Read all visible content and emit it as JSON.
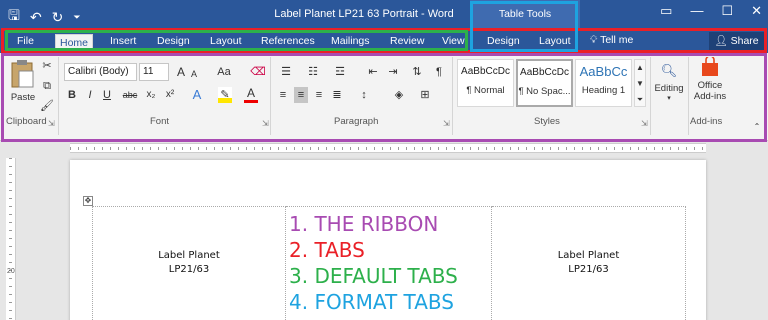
{
  "titlebar": {
    "title": "Label Planet LP21 63 Portrait  -  Word",
    "qat_icons": [
      "save-icon",
      "undo-icon",
      "redo-icon",
      "customize-qat-icon"
    ],
    "qat_glyphs": [
      "🖫",
      "↶",
      "↻",
      "⏷"
    ],
    "window_glyphs": [
      "▭",
      "—",
      "☐",
      "✕"
    ]
  },
  "contextual": {
    "title": "Table Tools"
  },
  "tabs": [
    {
      "label": "File"
    },
    {
      "label": "Home"
    },
    {
      "label": "Insert"
    },
    {
      "label": "Design"
    },
    {
      "label": "Layout"
    },
    {
      "label": "References"
    },
    {
      "label": "Mailings"
    },
    {
      "label": "Review"
    },
    {
      "label": "View"
    },
    {
      "label": "Design"
    },
    {
      "label": "Layout"
    }
  ],
  "tell_me": "Tell me",
  "share": "Share",
  "ribbon": {
    "clipboard": {
      "label": "Clipboard",
      "paste": "Paste"
    },
    "font": {
      "label": "Font",
      "font_name": "Calibri (Body)",
      "font_size": "11",
      "buttons": [
        "A",
        "A",
        "Aa",
        "B",
        "I",
        "U",
        "abc",
        "x₂",
        "x²",
        "A",
        "A"
      ]
    },
    "paragraph": {
      "label": "Paragraph"
    },
    "styles": {
      "label": "Styles",
      "items": [
        {
          "sample": "AaBbCcDc",
          "name": "¶ Normal"
        },
        {
          "sample": "AaBbCcDc",
          "name": "¶ No Spac..."
        },
        {
          "sample": "AaBbCc",
          "name": "Heading 1"
        }
      ]
    },
    "editing": {
      "label": "Editing"
    },
    "addins": {
      "label": "Add-ins",
      "office": "Office",
      "addins": "Add-ins"
    }
  },
  "document": {
    "left_cell": [
      "Label Planet",
      "LP21/63"
    ],
    "right_cell": [
      "Label Planet",
      "LP21/63"
    ],
    "annotations": [
      {
        "text": "1. THE RIBBON",
        "color": "#a84bb2"
      },
      {
        "text": "2. TABS",
        "color": "#ea2027"
      },
      {
        "text": "3. DEFAULT TABS",
        "color": "#2db04b"
      },
      {
        "text": "4. FORMAT TABS",
        "color": "#1ea3e0"
      }
    ],
    "ruler_number": "20"
  },
  "highlight_colors": {
    "ribbon": "#a84bb2",
    "tabs": "#ea2027",
    "default_tabs": "#2db04b",
    "format_tabs": "#1ea3e0"
  }
}
